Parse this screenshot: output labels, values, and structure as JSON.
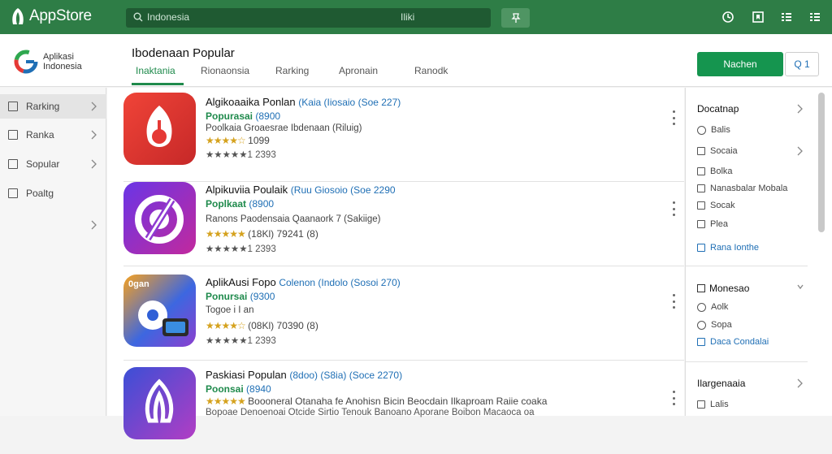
{
  "app": {
    "title": "AppStore"
  },
  "search": {
    "placeholder": "Indonesia",
    "right_text": "Iliki"
  },
  "brand": {
    "line1": "Aplikasi",
    "line2": "Indonesia"
  },
  "header": {
    "title": "Ibodenaan Popular",
    "tabs": [
      {
        "label": "Inaktania",
        "active": true
      },
      {
        "label": "Rionaonsia",
        "active": false
      },
      {
        "label": "Rarking",
        "active": false
      },
      {
        "label": "Apronain",
        "active": false
      },
      {
        "label": "Ranodk",
        "active": false
      }
    ],
    "primary_button": "Nachen",
    "secondary_button": "Q 1"
  },
  "sidebar": {
    "items": [
      {
        "label": "Rarking",
        "icon": "square-icon"
      },
      {
        "label": "Ranka",
        "icon": "square-icon"
      },
      {
        "label": "Sopular",
        "icon": "archive-icon"
      },
      {
        "label": "Poaltg",
        "icon": "tag-icon"
      }
    ]
  },
  "apps": [
    {
      "name": "Algikoaaika Ponlan",
      "meta": "(Kaia (Iiosaio (Soe 227)",
      "category": "Popurasai",
      "category_meta": "(8900",
      "desc": "Poolkaia Groaesrae Ibdenaan (Riluig)",
      "stars": "★★★★☆",
      "rating_text": "1099",
      "count": "★★★★★1 2393",
      "color": "#e53935"
    },
    {
      "name": "Alpikuviia Poulaik",
      "meta": "(Ruu Giosoio (Soe 2290",
      "category": "Poplkaat",
      "category_meta": "(8900",
      "desc": "Ranons Paodensaia Qaanaork 7 (Sakiige)",
      "stars": "★★★★★",
      "rating_text": "(18Kl) 79241 (8)",
      "count": "★★★★★1 2393",
      "color": "#8e3bd1"
    },
    {
      "name": "AplikAusi Fopo",
      "meta": "Colenon (Indolo (Sosoi 270)",
      "category": "Ponursai",
      "category_meta": "(9300",
      "desc": "Togoe i I an",
      "stars": "★★★★☆",
      "rating_text": "(08Kl) 70390 (8)",
      "count": "★★★★★1 2393",
      "color": "#2f5fd6",
      "badge": "0gan"
    },
    {
      "name": "Paskiasi Populan",
      "meta": "(8doo) (S8ia) (Soce 2270)",
      "category": "Poonsai",
      "category_meta": "(8940",
      "desc": "Boooneral Otanaha fe Anohisn Bicin Beocdain Ilkaproam Raiie coaka",
      "stars": "★★★★★",
      "rating_text": "",
      "count": "Bopoae Denoenoai Otcide Sirtio Tenouk Banoano Aporane Boibon Macaoca oa",
      "color": "#5e3bb8"
    }
  ],
  "right_panel": {
    "sections": [
      {
        "title": "Docatnap",
        "items": [
          {
            "label": "Balis",
            "icon": "circle-check-icon",
            "link": false
          },
          {
            "label": "Socaia",
            "icon": "square-icon",
            "link": false,
            "chevron": true
          },
          {
            "label": "Bolka",
            "icon": "edit-icon",
            "link": false
          },
          {
            "label": "Nanasbalar Mobala",
            "icon": "square-icon",
            "link": false
          },
          {
            "label": "Socak",
            "icon": "edit-icon",
            "link": false
          },
          {
            "label": "Plea",
            "icon": "square-icon",
            "link": false
          },
          {
            "label": "Rana Ionthe",
            "icon": "square-icon",
            "link": true
          }
        ]
      },
      {
        "title": "Monesao",
        "items": [
          {
            "label": "Aolk",
            "icon": "circle-icon",
            "link": false
          },
          {
            "label": "Sopa",
            "icon": "circle-icon",
            "link": false
          },
          {
            "label": "Daca Condalai",
            "icon": "edit-icon",
            "link": true
          }
        ]
      },
      {
        "title": "Ilargenaaia",
        "items": [
          {
            "label": "Lalis",
            "icon": "square-icon",
            "link": false
          }
        ]
      }
    ]
  }
}
